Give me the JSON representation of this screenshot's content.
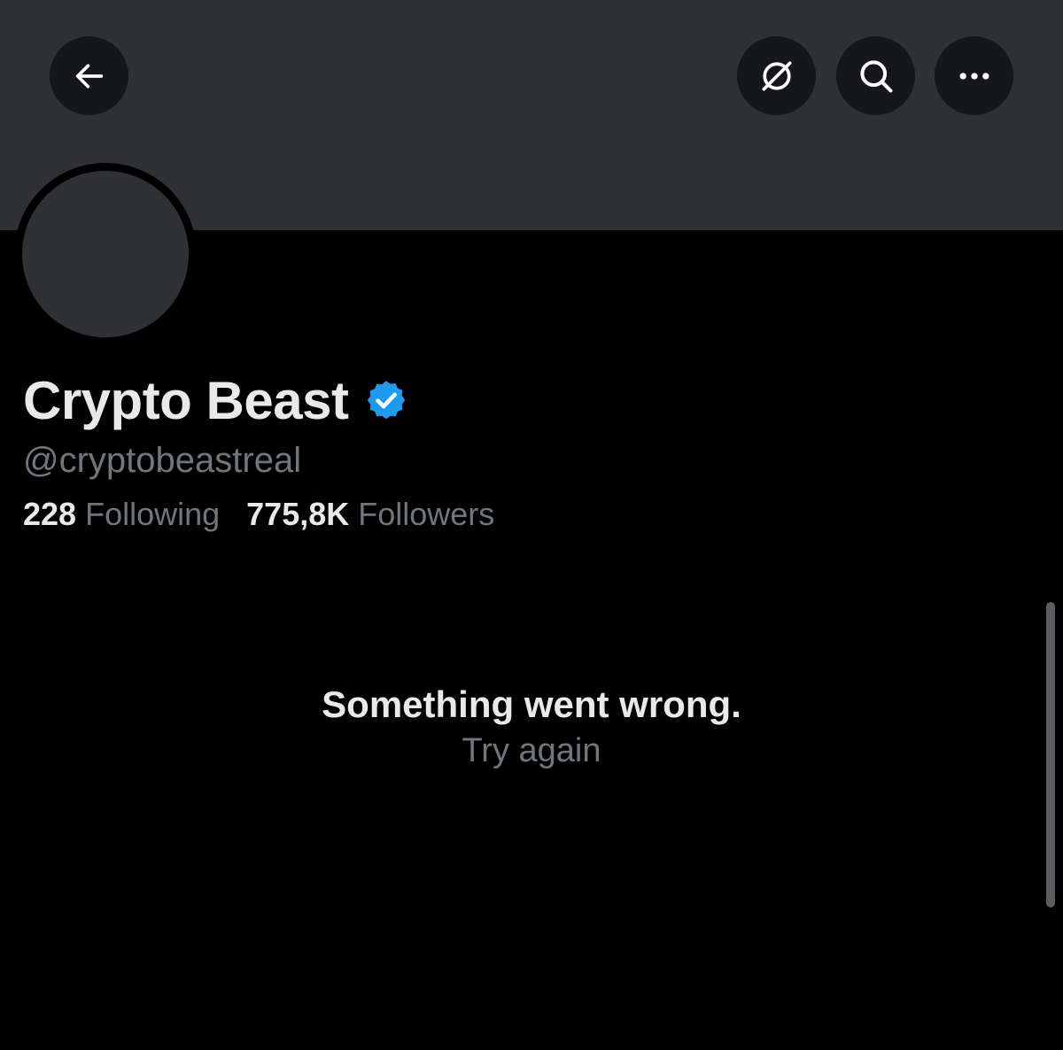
{
  "header": {
    "back_icon": "arrow-left-icon",
    "grok_icon": "grok-icon",
    "search_icon": "search-icon",
    "more_icon": "ellipsis-icon"
  },
  "profile": {
    "display_name": "Crypto Beast",
    "verified_icon": "verified-badge-icon",
    "handle": "@cryptobeastreal",
    "following_count": "228",
    "following_label": "Following",
    "followers_count": "775,8K",
    "followers_label": "Followers"
  },
  "error": {
    "title": "Something went wrong.",
    "retry_label": "Try again"
  },
  "colors": {
    "background": "#000000",
    "banner": "#2f3135",
    "button_bg": "#16171a",
    "primary_text": "#e7e9ea",
    "secondary_text": "#71767b",
    "verified_blue": "#1d9bf0"
  }
}
